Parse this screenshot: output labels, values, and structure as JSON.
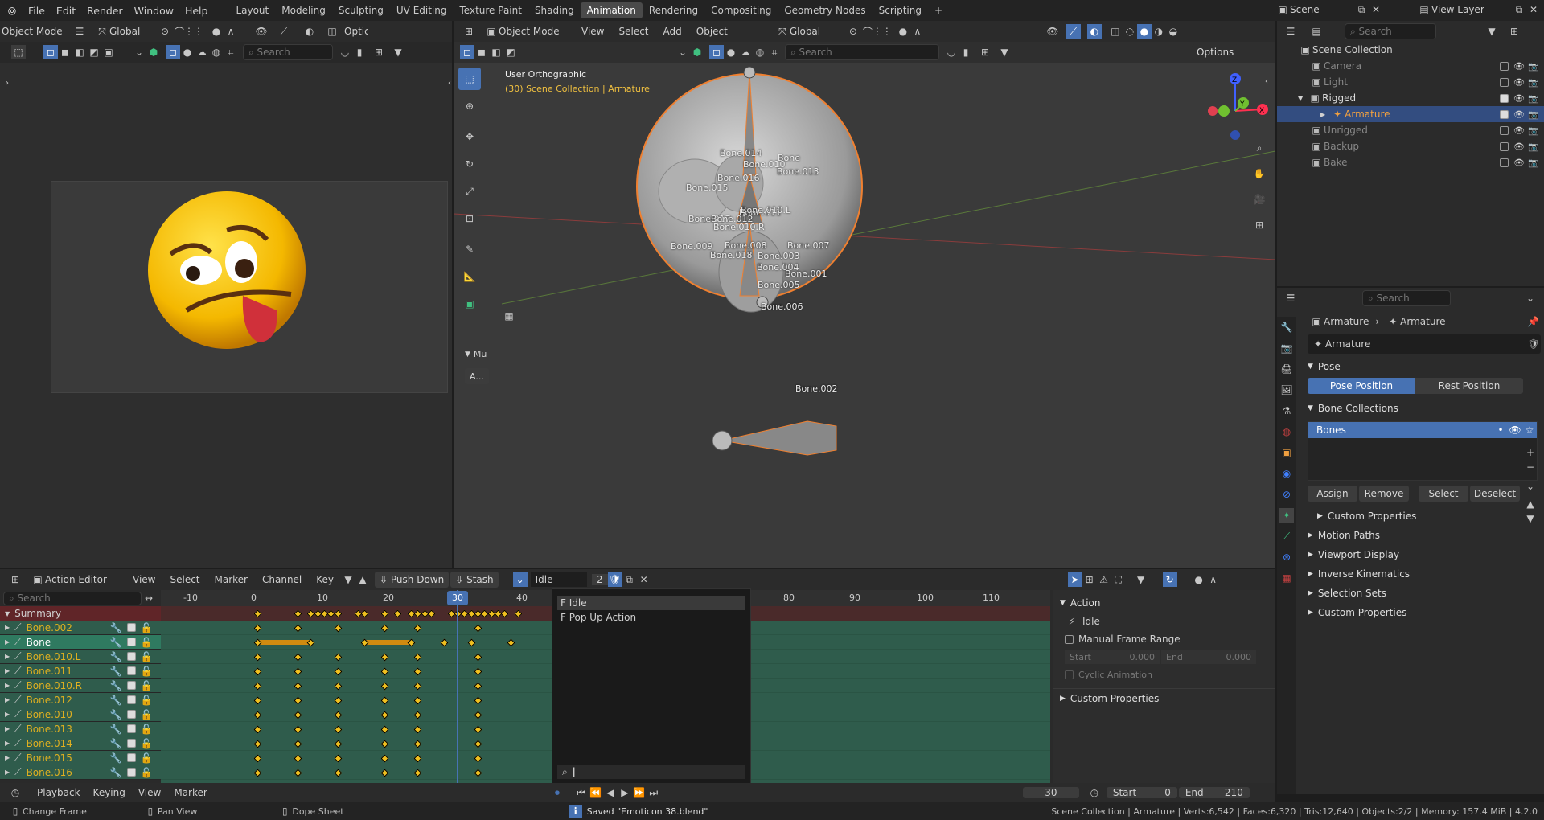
{
  "topbar": {
    "menus": [
      "File",
      "Edit",
      "Render",
      "Window",
      "Help"
    ],
    "workspaces": [
      "Layout",
      "Modeling",
      "Sculpting",
      "UV Editing",
      "Texture Paint",
      "Shading",
      "Animation",
      "Rendering",
      "Compositing",
      "Geometry Nodes",
      "Scripting"
    ],
    "active_workspace": "Animation",
    "scene": "Scene",
    "view_layer": "View Layer"
  },
  "left_view": {
    "mode": "Object Mode",
    "transform": "Global",
    "search_placeholder": "Search",
    "options": "Optic"
  },
  "viewport": {
    "mode": "Object Mode",
    "menus": [
      "View",
      "Select",
      "Add",
      "Object"
    ],
    "transform": "Global",
    "search_placeholder": "Search",
    "options": "Options",
    "view_name": "User Orthographic",
    "collection_info": "(30) Scene Collection | Armature",
    "side_label": "Mu",
    "side_btn": "A...",
    "bones": [
      "Bone.014",
      "Bone",
      "Bone.010",
      "Bone.013",
      "Bone.016",
      "Bone.015",
      "Bone.017",
      "Bone.012",
      "Bone.010.R",
      "Bone.011",
      "Bone.010.L",
      "Bone.009",
      "Bone.008",
      "Bone.007",
      "Bone.018",
      "Bone.003",
      "Bone.004",
      "Bone.001",
      "Bone.005",
      "Bone.006",
      "Bone.002"
    ],
    "axes": {
      "z": "Z",
      "y": "Y",
      "x": "X"
    }
  },
  "outliner": {
    "search_placeholder": "Search",
    "root": "Scene Collection",
    "items": [
      {
        "name": "Camera",
        "vis": false
      },
      {
        "name": "Light",
        "vis": false
      },
      {
        "name": "Rigged",
        "vis": true
      },
      {
        "name": "Armature",
        "vis": true
      },
      {
        "name": "Unrigged",
        "vis": false
      },
      {
        "name": "Backup",
        "vis": false
      },
      {
        "name": "Bake",
        "vis": false
      }
    ]
  },
  "properties": {
    "search_placeholder": "Search",
    "breadcrumb": [
      "Armature",
      "Armature"
    ],
    "datablock": "Armature",
    "pose_title": "Pose",
    "pose_position": "Pose Position",
    "rest_position": "Rest Position",
    "bone_collections_title": "Bone Collections",
    "collection": "Bones",
    "buttons": [
      "Assign",
      "Remove",
      "Select",
      "Deselect"
    ],
    "custom_props": "Custom Properties",
    "sections": [
      "Motion Paths",
      "Viewport Display",
      "Inverse Kinematics",
      "Selection Sets",
      "Custom Properties"
    ]
  },
  "action_editor": {
    "editor": "Action Editor",
    "menus": [
      "View",
      "Select",
      "Marker",
      "Channel",
      "Key"
    ],
    "push_down": "Push Down",
    "stash": "Stash",
    "action": "Idle",
    "users": "2",
    "search_placeholder": "Search",
    "frames": [
      "-10",
      "0",
      "10",
      "20",
      "30",
      "40",
      "80",
      "90",
      "100",
      "110"
    ],
    "current_frame": "30",
    "summary": "Summary",
    "channels": [
      "Bone.002",
      "Bone",
      "Bone.010.L",
      "Bone.011",
      "Bone.010.R",
      "Bone.012",
      "Bone.010",
      "Bone.013",
      "Bone.014",
      "Bone.015",
      "Bone.016"
    ],
    "dropdown": [
      "F Idle",
      "F Pop Up Action"
    ],
    "action_panel": {
      "title": "Action",
      "name": "Idle",
      "manual_range": "Manual Frame Range",
      "start_label": "Start",
      "start_val": "0.000",
      "end_label": "End",
      "end_val": "0.000",
      "cyclic": "Cyclic Animation",
      "custom_props": "Custom Properties"
    }
  },
  "timeline": {
    "menus": [
      "Playback",
      "Keying",
      "View",
      "Marker"
    ],
    "frame": "30",
    "start_label": "Start",
    "start": "0",
    "end_label": "End",
    "end": "210"
  },
  "statusbar": {
    "left": [
      "Change Frame",
      "Pan View",
      "Dope Sheet"
    ],
    "message": "Saved \"Emoticon 38.blend\"",
    "stats": "Scene Collection | Armature | Verts:6,542 | Faces:6,320 | Tris:12,640 | Objects:2/2 | Memory: 157.4 MiB | 4.2.0"
  },
  "colors": {
    "accent": "#4772b3",
    "selected_orange": "#f08030",
    "keyframe": "#f0c020",
    "channel_green": "#2f5c4c"
  }
}
